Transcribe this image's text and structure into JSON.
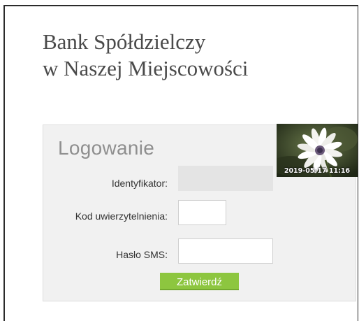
{
  "bank": {
    "name_line1": "Bank Spółdzielczy",
    "name_line2": "w Naszej Miejscowości"
  },
  "login": {
    "title": "Logowanie",
    "identifier_label": "Identyfikator:",
    "identifier_value": "",
    "auth_code_label": "Kod uwierzytelnienia:",
    "auth_code_value": "",
    "sms_password_label": "Hasło SMS:",
    "sms_password_value": "",
    "submit_label": "Zatwierdź"
  },
  "photo": {
    "date_stamp": "2019-05-17 11:16",
    "icon": "daisy-flower-photo"
  },
  "colors": {
    "accent_button": "#8dc63f",
    "panel_background": "#f1f1f1",
    "title_text": "#4a4a4a"
  }
}
